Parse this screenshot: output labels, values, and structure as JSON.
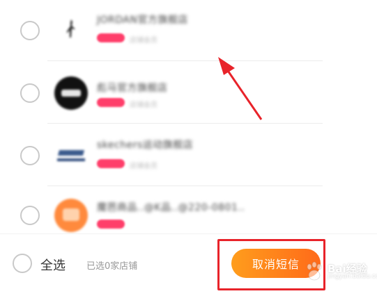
{
  "stores": [
    {
      "name": "JORDAN官方旗舰店",
      "logo_icon": "jordan-logo",
      "tag_color": "#ff3e6a",
      "sub": "店铺会员"
    },
    {
      "name": "彪马官方旗舰店",
      "logo_icon": "puma-logo",
      "tag_color": "#ff3e6a",
      "sub": "店铺会员"
    },
    {
      "name": "skechers运动旗舰店",
      "logo_icon": "skechers-logo",
      "tag_color": "#ff3e6a",
      "sub": "店铺会员"
    },
    {
      "name": "魔芭商品..@K品..@220-0801..",
      "logo_icon": "orange-store-logo",
      "tag_color": "#ff3e6a",
      "sub": ""
    }
  ],
  "footer": {
    "select_all_label": "全选",
    "selected_count_text": "已选0家店铺",
    "cancel_sms_label": "取消短信"
  },
  "colors": {
    "button_gradient_start": "#ff9d1c",
    "button_gradient_end": "#ff6a1a",
    "annotation_red": "#e8232a"
  },
  "watermark": {
    "brand": "Bai",
    "brand2": "经验",
    "sub": "jingyan.baidu.com"
  }
}
